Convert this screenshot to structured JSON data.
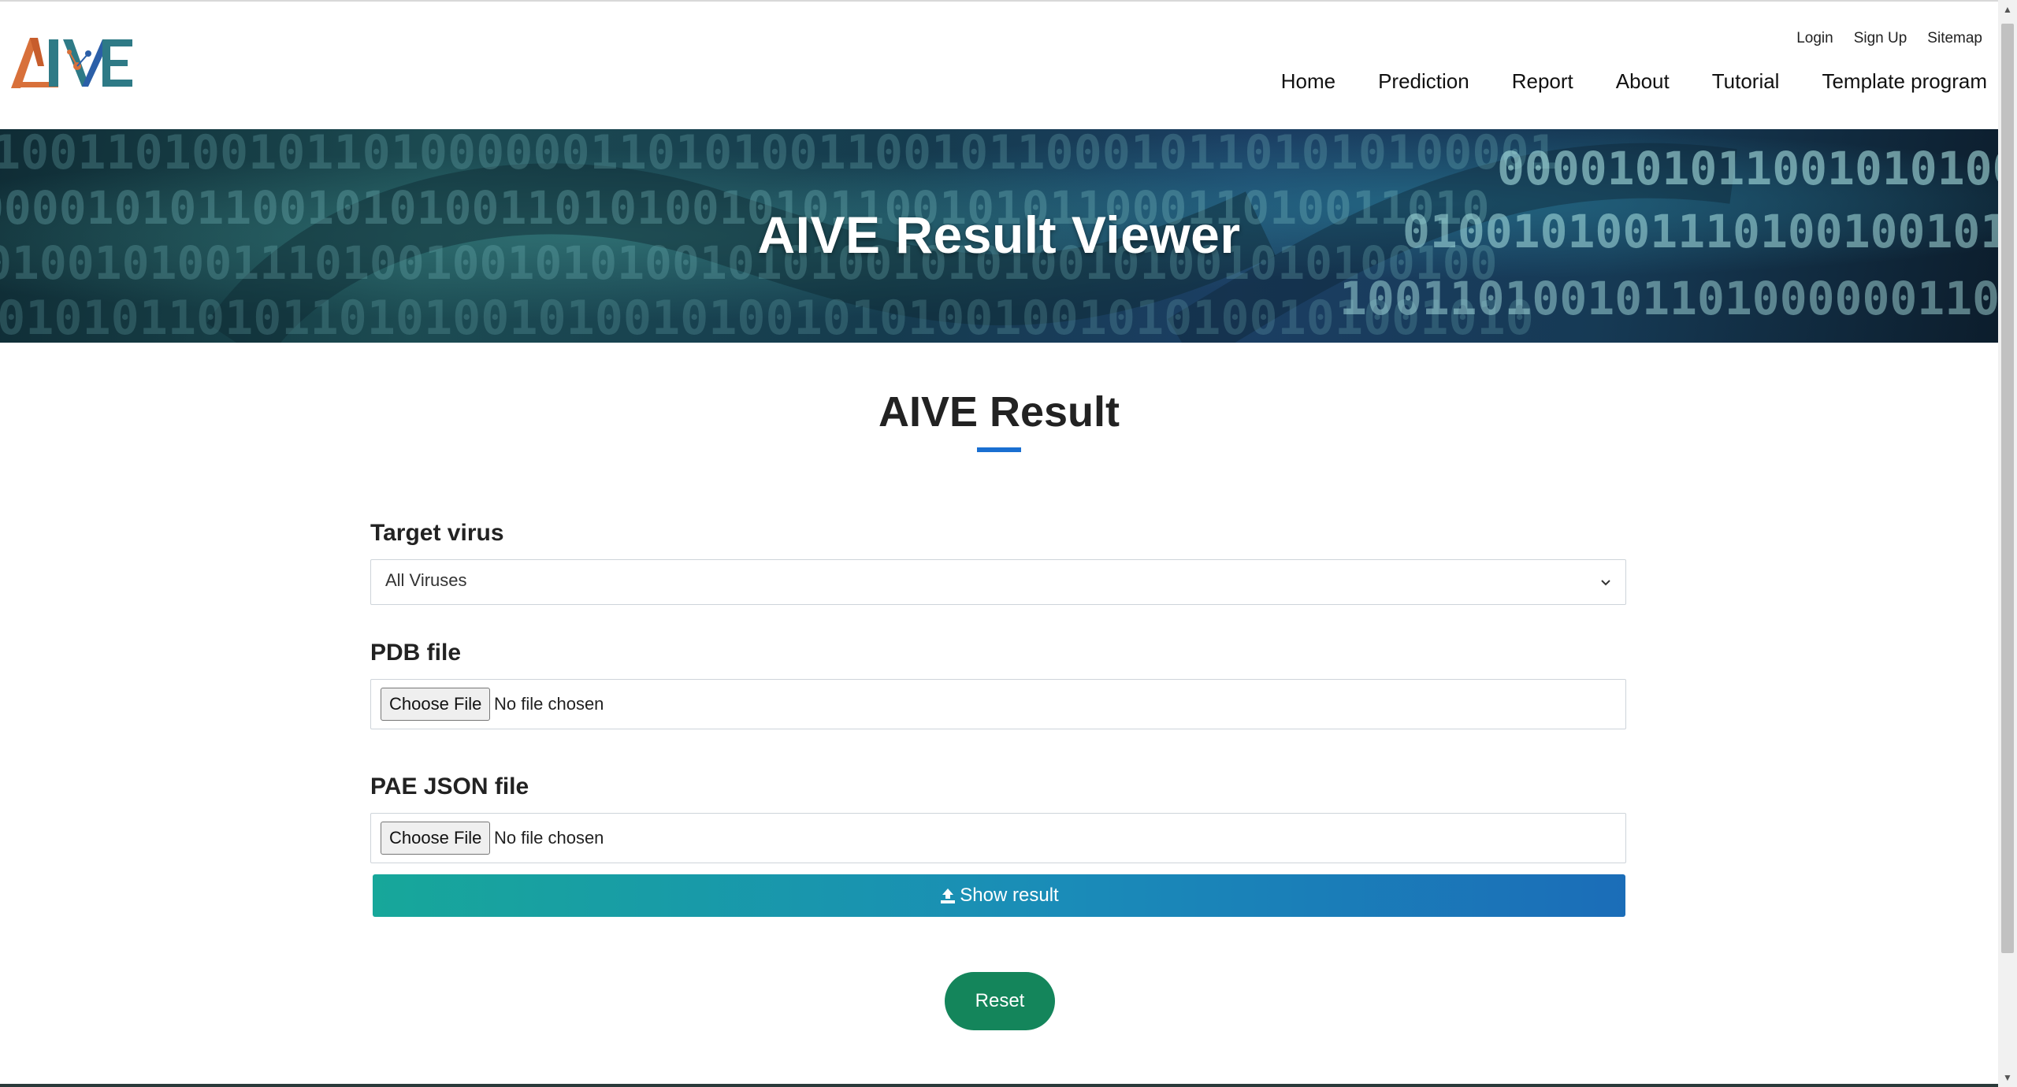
{
  "brand": {
    "logo_text": "AIVE",
    "colors": {
      "logo_orange": "#d8703a",
      "logo_teal": "#2e7a86",
      "logo_blue": "#2b5fa8"
    }
  },
  "header": {
    "util_nav": [
      "Login",
      "Sign Up",
      "Sitemap"
    ],
    "main_nav": [
      "Home",
      "Prediction",
      "Report",
      "About",
      "Tutorial",
      "Template program"
    ]
  },
  "hero": {
    "title": "AIVE Result Viewer",
    "binary_rows": [
      "1001101001011010000001101010011001011000101101010100001",
      "0000101011001010100110101001010110010101100011010011010",
      "0100101001110100100101010010101001010100101001010100100",
      "1010101101011010100101001010010101001001010100101001010"
    ]
  },
  "main": {
    "section_title": "AIVE Result",
    "target_virus": {
      "label": "Target virus",
      "selected": "All Viruses"
    },
    "pdb": {
      "label": "PDB file",
      "button": "Choose File",
      "status": "No file chosen"
    },
    "pae": {
      "label": "PAE JSON file",
      "button": "Choose File",
      "status": "No file chosen"
    },
    "show_result": {
      "label": "Show result",
      "icon": "upload-icon"
    },
    "reset": {
      "label": "Reset"
    }
  },
  "colors": {
    "accent_underline": "#1a6fd1",
    "show_gradient_start": "#17a79a",
    "show_gradient_end": "#1b6db8",
    "reset": "#14855b"
  }
}
